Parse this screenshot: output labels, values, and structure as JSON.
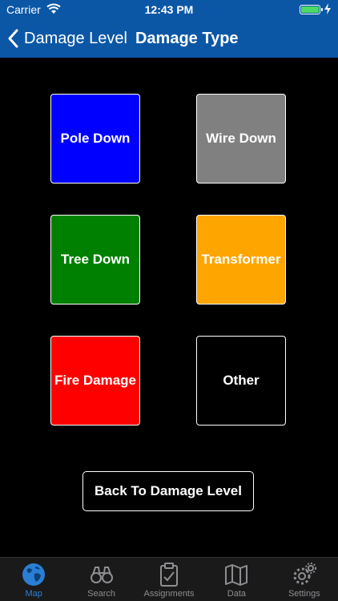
{
  "status_bar": {
    "carrier": "Carrier",
    "time": "12:43 PM"
  },
  "nav": {
    "back_label": "Damage Level",
    "title": "Damage Type"
  },
  "tiles": [
    {
      "label": "Pole Down",
      "color": "#0000ff"
    },
    {
      "label": "Wire Down",
      "color": "#808080"
    },
    {
      "label": "Tree Down",
      "color": "#008000"
    },
    {
      "label": "Transformer",
      "color": "#ffa500"
    },
    {
      "label": "Fire Damage",
      "color": "#ff0000"
    },
    {
      "label": "Other",
      "color": "#000000"
    }
  ],
  "back_button": {
    "label": "Back To Damage Level"
  },
  "tabs": [
    {
      "label": "Map",
      "icon": "globe-icon",
      "active": true
    },
    {
      "label": "Search",
      "icon": "binoculars-icon",
      "active": false
    },
    {
      "label": "Assignments",
      "icon": "clipboard-icon",
      "active": false
    },
    {
      "label": "Data",
      "icon": "map-icon",
      "active": false
    },
    {
      "label": "Settings",
      "icon": "gear-icon",
      "active": false
    }
  ],
  "colors": {
    "nav_bg": "#0b57a6",
    "tab_active": "#2a7fd4",
    "tab_inactive": "#8e8e93"
  }
}
